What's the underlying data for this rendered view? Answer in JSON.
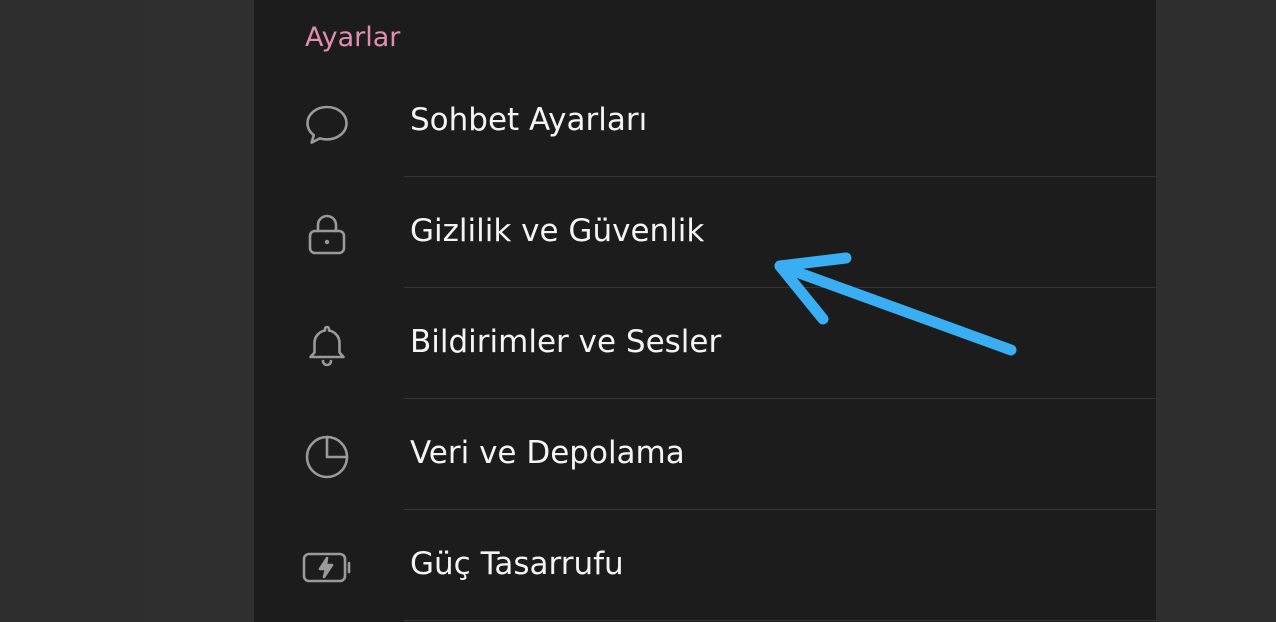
{
  "settings": {
    "section_title": "Ayarlar",
    "items": [
      {
        "label": "Sohbet Ayarları",
        "icon": "chat-bubble-icon"
      },
      {
        "label": "Gizlilik ve Güvenlik",
        "icon": "lock-icon"
      },
      {
        "label": "Bildirimler ve Sesler",
        "icon": "bell-icon"
      },
      {
        "label": "Veri ve Depolama",
        "icon": "pie-chart-icon"
      },
      {
        "label": "Güç Tasarrufu",
        "icon": "battery-charging-icon"
      }
    ]
  },
  "colors": {
    "accent": "#e08fb2",
    "panel_background": "#1c1c1c",
    "page_background": "#2f2f2f",
    "text": "#f4f4f4",
    "icon": "#9a9a9a",
    "annotation_arrow": "#3aaef2"
  }
}
